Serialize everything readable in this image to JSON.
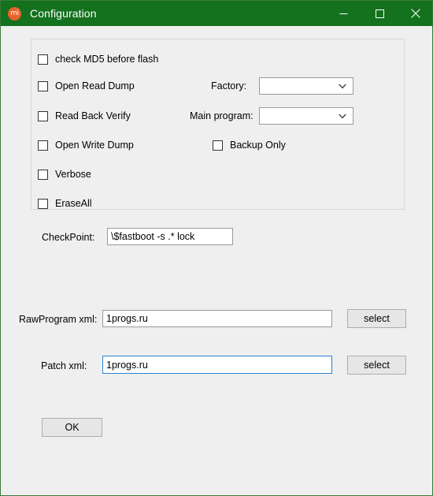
{
  "window": {
    "title": "Configuration",
    "icon_name": "mi-logo-icon",
    "icon_text": "mi",
    "titlebar_color": "#14711e",
    "border_color": "#3a7a3a",
    "background_color": "#efefef",
    "controls": {
      "minimize_label": "Minimize",
      "maximize_label": "Maximize",
      "close_label": "Close"
    }
  },
  "options_group": {
    "checkboxes": [
      {
        "label": "check MD5 before flash",
        "checked": false
      },
      {
        "label": "Open Read Dump",
        "checked": false
      },
      {
        "label": "Read Back Verify",
        "checked": false
      },
      {
        "label": "Open Write Dump",
        "checked": false
      },
      {
        "label": "Verbose",
        "checked": false
      },
      {
        "label": "EraseAll",
        "checked": false
      }
    ],
    "factory": {
      "label": "Factory:",
      "value": "",
      "options": []
    },
    "main_program": {
      "label": "Main program:",
      "value": "",
      "options": []
    },
    "backup_only": {
      "label": "Backup Only",
      "checked": false
    }
  },
  "checkpoint": {
    "label": "CheckPoint:",
    "value": "\\$fastboot -s .* lock",
    "placeholder": ""
  },
  "rawprogram": {
    "label": "RawProgram xml:",
    "value": "1progs.ru",
    "placeholder": "",
    "select_label": "select",
    "focused": false
  },
  "patch": {
    "label": "Patch xml:",
    "value": "1progs.ru",
    "placeholder": "",
    "select_label": "select",
    "focused": true
  },
  "footer": {
    "ok_label": "OK"
  },
  "colors": {
    "accent_focus": "#2782d6",
    "titlebar": "#14711e",
    "icon_orange": "#e8622c"
  }
}
